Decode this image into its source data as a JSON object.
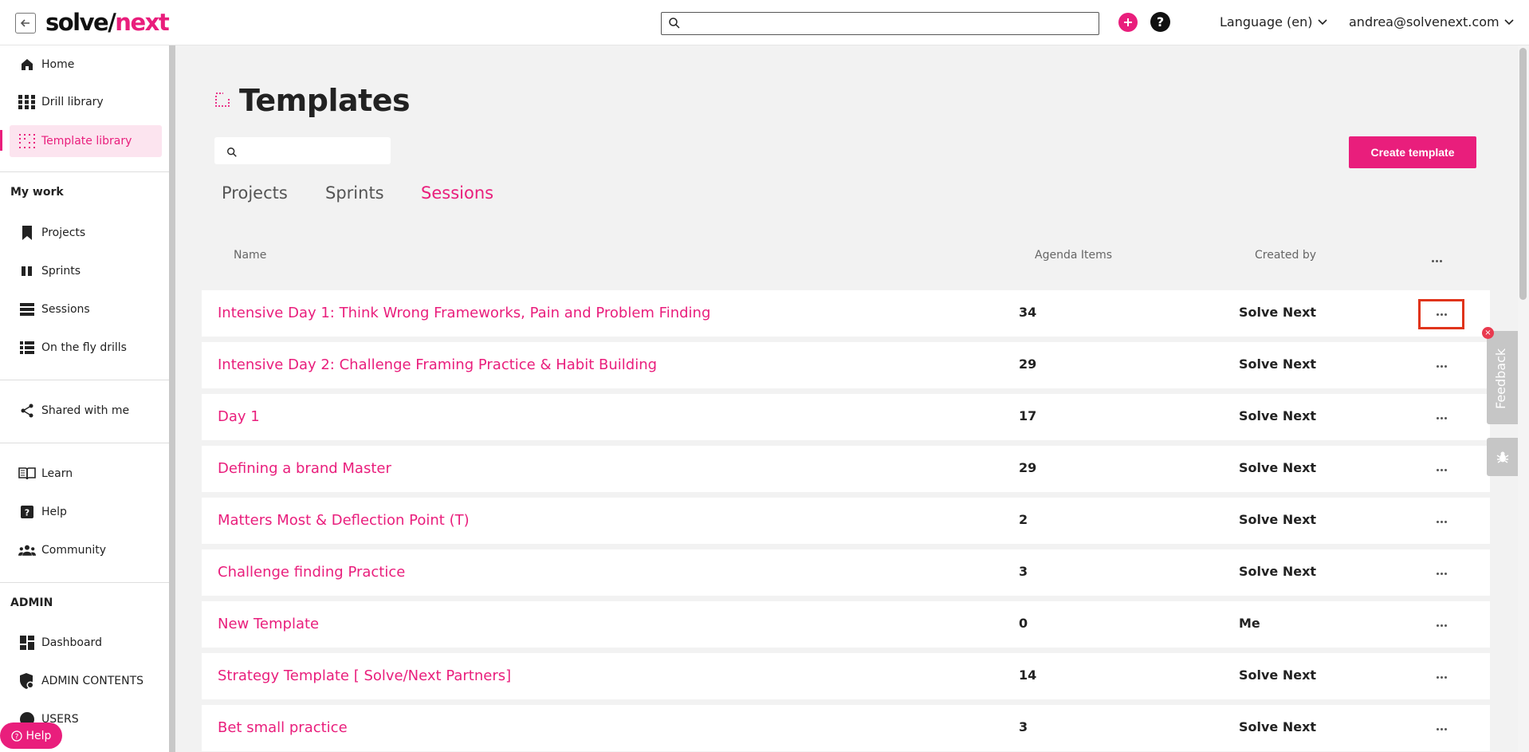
{
  "header": {
    "logo_prefix": "solve/",
    "logo_accent": "next",
    "search_placeholder": "",
    "language_label": "Language (en)",
    "user_label": "andrea@solvenext.com"
  },
  "sidebar": {
    "top_items": [
      {
        "label": "Home",
        "icon": "home-icon"
      },
      {
        "label": "Drill library",
        "icon": "grid-icon"
      },
      {
        "label": "Template library",
        "icon": "dotted-grid-icon",
        "active": true
      }
    ],
    "my_work_heading": "My work",
    "my_work_items": [
      {
        "label": "Projects",
        "icon": "bookmark-icon"
      },
      {
        "label": "Sprints",
        "icon": "columns-icon"
      },
      {
        "label": "Sessions",
        "icon": "stack-icon"
      },
      {
        "label": "On the fly drills",
        "icon": "list-icon"
      }
    ],
    "shared_label": "Shared with me",
    "support_items": [
      {
        "label": "Learn",
        "icon": "book-icon"
      },
      {
        "label": "Help",
        "icon": "help-square-icon"
      },
      {
        "label": "Community",
        "icon": "people-icon"
      }
    ],
    "admin_heading": "ADMIN",
    "admin_items": [
      {
        "label": "Dashboard",
        "icon": "dashboard-icon"
      },
      {
        "label": "ADMIN CONTENTS",
        "icon": "shield-icon"
      },
      {
        "label": "USERS",
        "icon": "user-icon"
      }
    ],
    "help_pill_label": "Help"
  },
  "main": {
    "title": "Templates",
    "search_placeholder": "",
    "create_button": "Create template",
    "tabs": [
      {
        "label": "Projects",
        "active": false
      },
      {
        "label": "Sprints",
        "active": false
      },
      {
        "label": "Sessions",
        "active": true
      }
    ],
    "columns": {
      "name": "Name",
      "agenda": "Agenda Items",
      "created_by": "Created by"
    },
    "rows": [
      {
        "name": "Intensive Day 1: Think Wrong Frameworks, Pain and Problem Finding",
        "agenda_items": "34",
        "created_by": "Solve Next"
      },
      {
        "name": "Intensive Day 2: Challenge Framing Practice & Habit Building",
        "agenda_items": "29",
        "created_by": "Solve Next"
      },
      {
        "name": "Day 1",
        "agenda_items": "17",
        "created_by": "Solve Next"
      },
      {
        "name": "Defining a brand Master",
        "agenda_items": "29",
        "created_by": "Solve Next"
      },
      {
        "name": "Matters Most & Deflection Point (T)",
        "agenda_items": "2",
        "created_by": "Solve Next"
      },
      {
        "name": "Challenge finding Practice",
        "agenda_items": "3",
        "created_by": "Solve Next"
      },
      {
        "name": "New Template",
        "agenda_items": "0",
        "created_by": "Me"
      },
      {
        "name": "Strategy Template [ Solve/Next Partners]",
        "agenda_items": "14",
        "created_by": "Solve Next"
      },
      {
        "name": "Bet small practice",
        "agenda_items": "3",
        "created_by": "Solve Next"
      }
    ]
  },
  "widgets": {
    "feedback_label": "Feedback"
  },
  "colors": {
    "accent": "#e91e7c",
    "highlight_box": "#e0341b"
  }
}
